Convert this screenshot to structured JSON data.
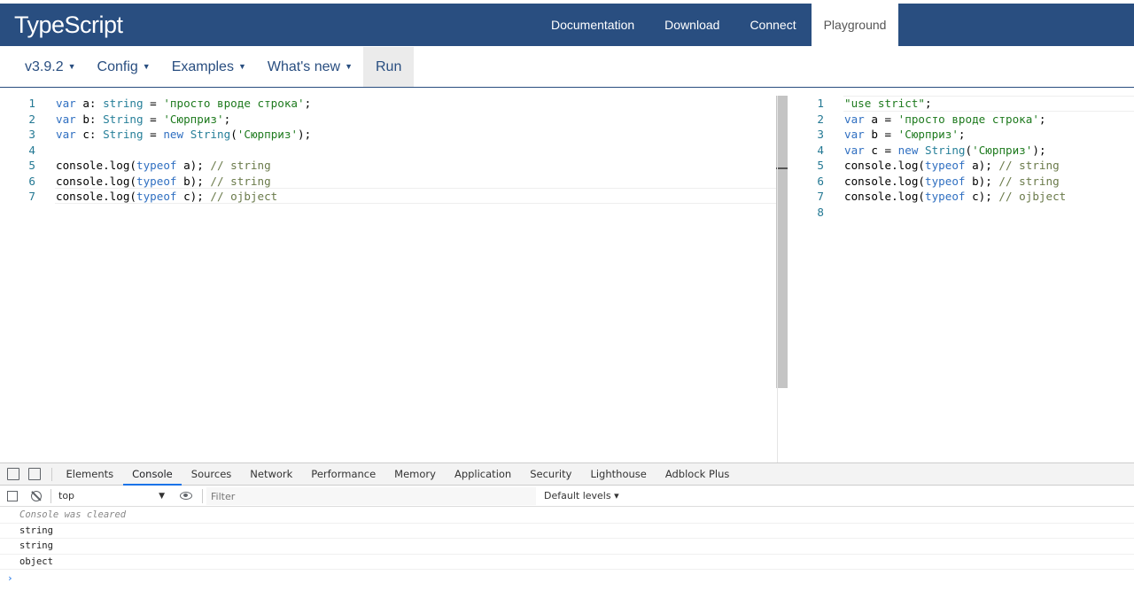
{
  "navbar": {
    "brand_prefix": "Type",
    "brand_suffix": "Script",
    "links": [
      "Documentation",
      "Download",
      "Connect",
      "Playground"
    ],
    "active": "Playground"
  },
  "subbar": {
    "version": "v3.9.2",
    "config": "Config",
    "examples": "Examples",
    "whats_new": "What's new",
    "run": "Run"
  },
  "editor_left": {
    "lines": [
      {
        "n": "1",
        "tokens": [
          [
            "k",
            "var"
          ],
          [
            "p",
            " a: "
          ],
          [
            "t",
            "string"
          ],
          [
            "p",
            " = "
          ],
          [
            "s",
            "'просто вроде строка'"
          ],
          [
            "p",
            ";"
          ]
        ]
      },
      {
        "n": "2",
        "tokens": [
          [
            "k",
            "var"
          ],
          [
            "p",
            " b: "
          ],
          [
            "t",
            "String"
          ],
          [
            "p",
            " = "
          ],
          [
            "s",
            "'Сюрприз'"
          ],
          [
            "p",
            ";"
          ]
        ]
      },
      {
        "n": "3",
        "tokens": [
          [
            "k",
            "var"
          ],
          [
            "p",
            " c: "
          ],
          [
            "t",
            "String"
          ],
          [
            "p",
            " = "
          ],
          [
            "k",
            "new"
          ],
          [
            "p",
            " "
          ],
          [
            "t",
            "String"
          ],
          [
            "p",
            "("
          ],
          [
            "s",
            "'Сюрприз'"
          ],
          [
            "p",
            ");"
          ]
        ]
      },
      {
        "n": "4",
        "tokens": []
      },
      {
        "n": "5",
        "tokens": [
          [
            "p",
            "console.log("
          ],
          [
            "k",
            "typeof"
          ],
          [
            "p",
            " a); "
          ],
          [
            "c",
            "// string"
          ]
        ]
      },
      {
        "n": "6",
        "tokens": [
          [
            "p",
            "console.log("
          ],
          [
            "k",
            "typeof"
          ],
          [
            "p",
            " b); "
          ],
          [
            "c",
            "// string"
          ]
        ]
      },
      {
        "n": "7",
        "tokens": [
          [
            "p",
            "console.log("
          ],
          [
            "k",
            "typeof"
          ],
          [
            "p",
            " c); "
          ],
          [
            "c",
            "// ojbject"
          ]
        ]
      }
    ]
  },
  "editor_right": {
    "lines": [
      {
        "n": "1",
        "tokens": [
          [
            "s",
            "\"use strict\""
          ],
          [
            "p",
            ";"
          ]
        ]
      },
      {
        "n": "2",
        "tokens": [
          [
            "k",
            "var"
          ],
          [
            "p",
            " a = "
          ],
          [
            "s",
            "'просто вроде строка'"
          ],
          [
            "p",
            ";"
          ]
        ]
      },
      {
        "n": "3",
        "tokens": [
          [
            "k",
            "var"
          ],
          [
            "p",
            " b = "
          ],
          [
            "s",
            "'Сюрприз'"
          ],
          [
            "p",
            ";"
          ]
        ]
      },
      {
        "n": "4",
        "tokens": [
          [
            "k",
            "var"
          ],
          [
            "p",
            " c = "
          ],
          [
            "k",
            "new"
          ],
          [
            "p",
            " "
          ],
          [
            "t",
            "String"
          ],
          [
            "p",
            "("
          ],
          [
            "s",
            "'Сюрприз'"
          ],
          [
            "p",
            ");"
          ]
        ]
      },
      {
        "n": "5",
        "tokens": [
          [
            "p",
            "console.log("
          ],
          [
            "k",
            "typeof"
          ],
          [
            "p",
            " a); "
          ],
          [
            "c",
            "// string"
          ]
        ]
      },
      {
        "n": "6",
        "tokens": [
          [
            "p",
            "console.log("
          ],
          [
            "k",
            "typeof"
          ],
          [
            "p",
            " b); "
          ],
          [
            "c",
            "// string"
          ]
        ]
      },
      {
        "n": "7",
        "tokens": [
          [
            "p",
            "console.log("
          ],
          [
            "k",
            "typeof"
          ],
          [
            "p",
            " c); "
          ],
          [
            "c",
            "// ojbject"
          ]
        ]
      },
      {
        "n": "8",
        "tokens": []
      }
    ]
  },
  "devtools": {
    "tabs": [
      "Elements",
      "Console",
      "Sources",
      "Network",
      "Performance",
      "Memory",
      "Application",
      "Security",
      "Lighthouse",
      "Adblock Plus"
    ],
    "active_tab": "Console",
    "context": "top",
    "filter_placeholder": "Filter",
    "levels": "Default levels ▾",
    "messages": [
      "Console was cleared",
      "string",
      "string",
      "object"
    ],
    "prompt": "›"
  },
  "colors": {
    "navbar": "#294e80",
    "keyword": "#2f6fc1",
    "type": "#267f99",
    "string": "#1e7a1e",
    "comment": "#6a7a4a",
    "line_number": "#237893"
  }
}
